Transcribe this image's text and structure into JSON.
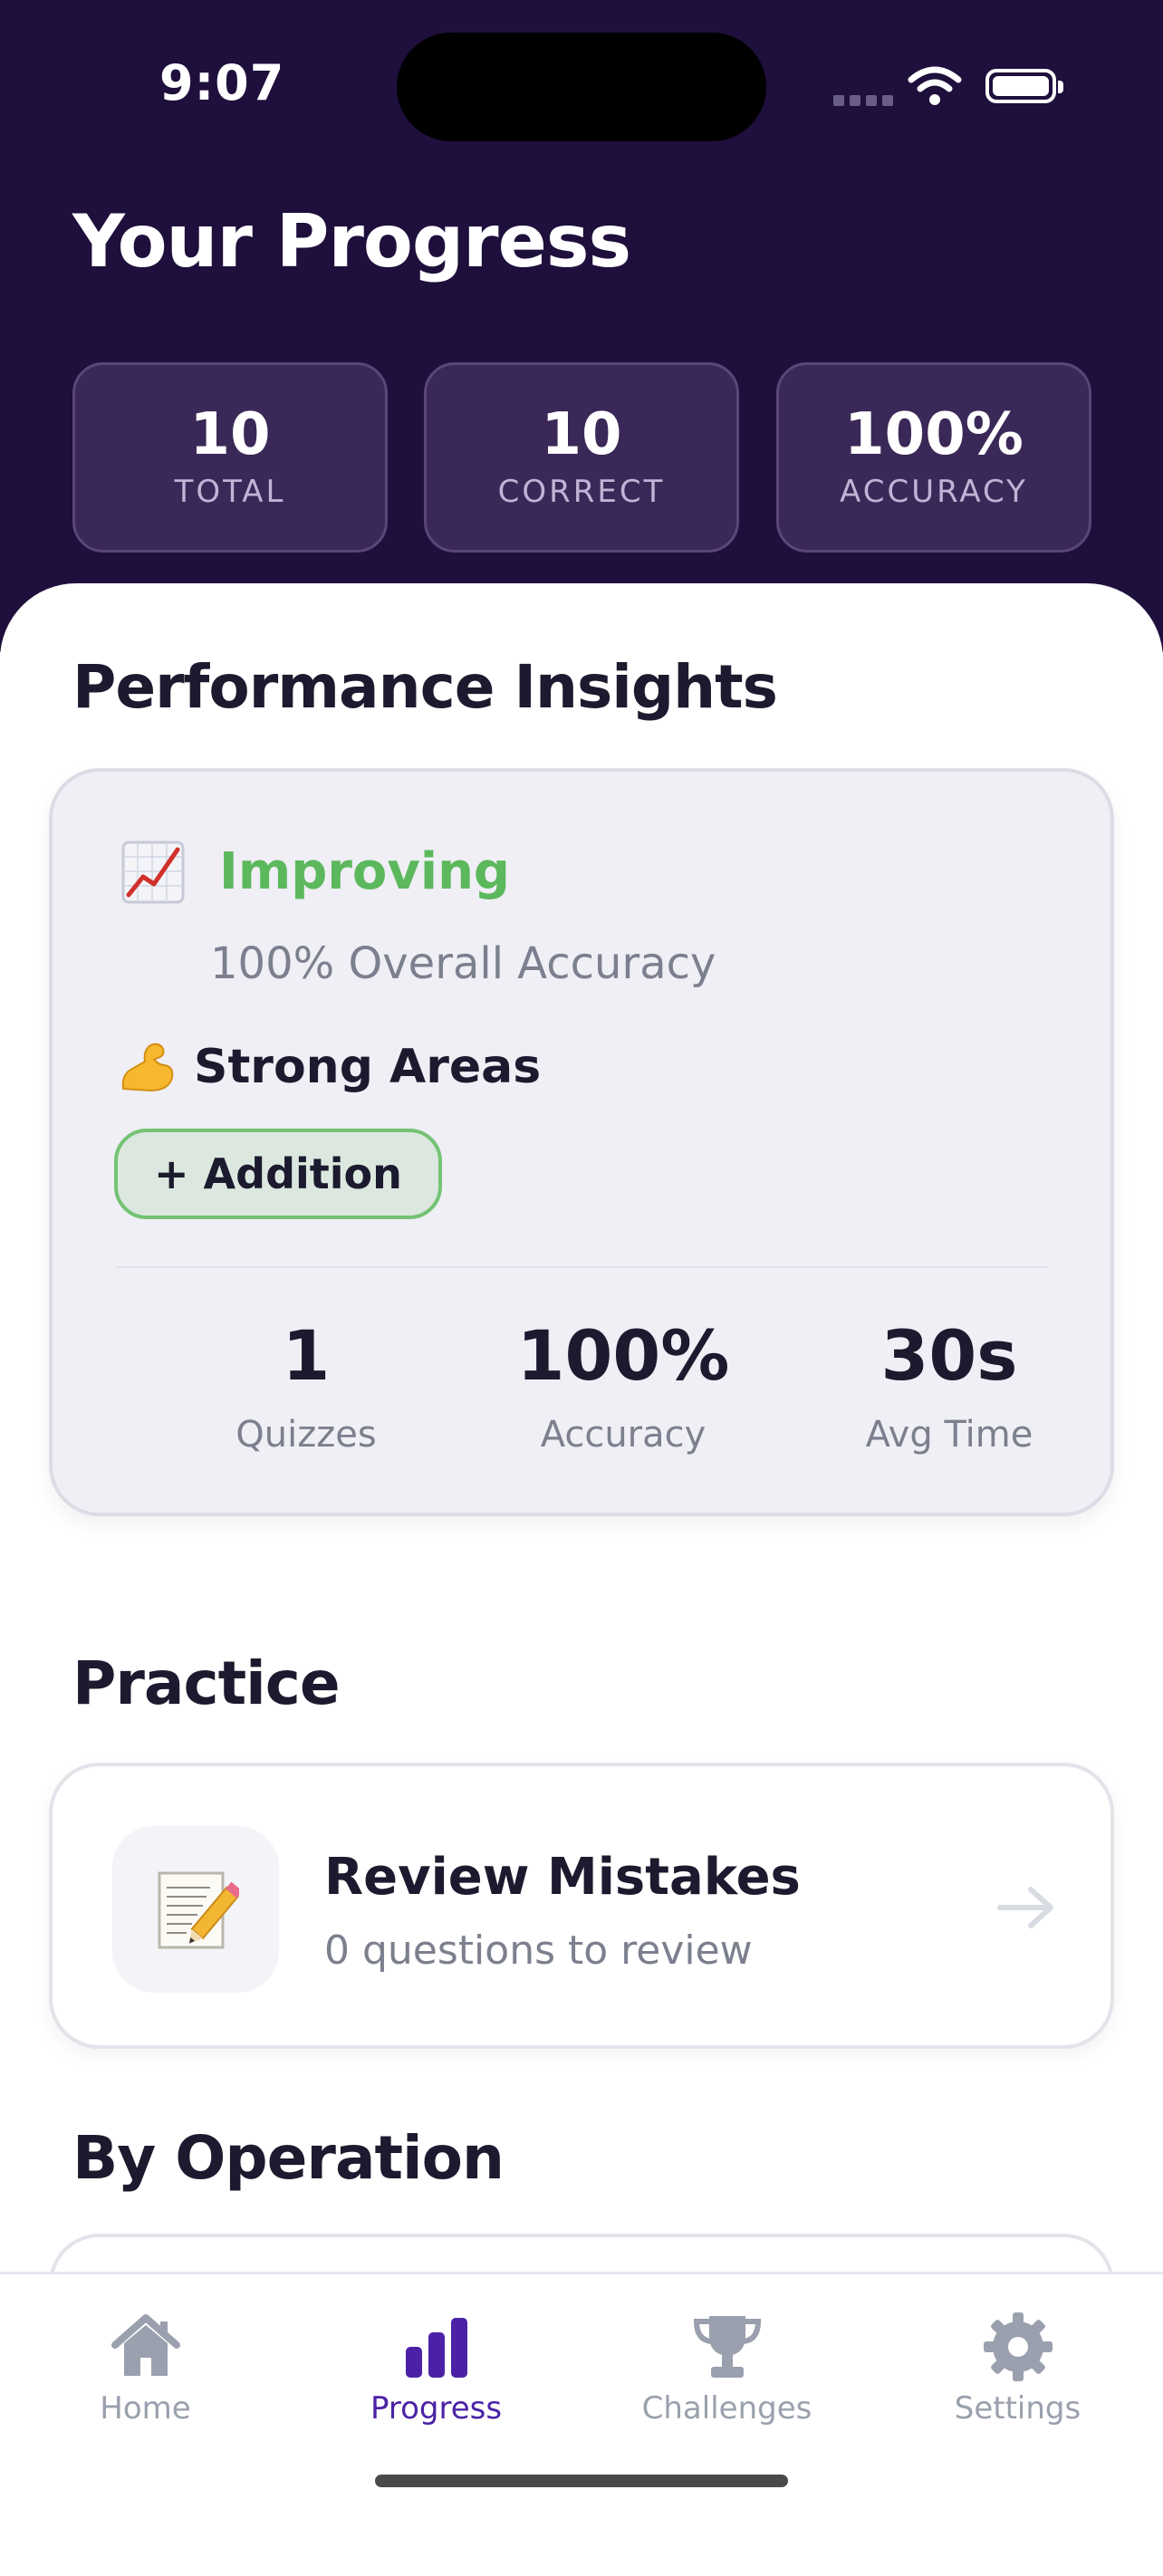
{
  "status_bar": {
    "time": "9:07"
  },
  "header": {
    "title": "Your Progress",
    "stats": [
      {
        "value": "10",
        "label": "TOTAL"
      },
      {
        "value": "10",
        "label": "CORRECT"
      },
      {
        "value": "100%",
        "label": "ACCURACY"
      }
    ]
  },
  "insights": {
    "section_title": "Performance Insights",
    "trend_icon": "chart-increasing-icon",
    "trend_label": "Improving",
    "overall_accuracy": "100% Overall Accuracy",
    "strong_areas_title": "Strong Areas",
    "strong_areas_icon": "flexed-biceps-icon",
    "strong_areas": [
      "+ Addition"
    ],
    "stats": [
      {
        "value": "1",
        "label": "Quizzes"
      },
      {
        "value": "100%",
        "label": "Accuracy"
      },
      {
        "value": "30s",
        "label": "Avg Time"
      }
    ]
  },
  "practice": {
    "section_title": "Practice",
    "review": {
      "icon": "memo-icon",
      "title": "Review Mistakes",
      "subtitle": "0 questions to review"
    }
  },
  "by_operation": {
    "section_title": "By Operation"
  },
  "tab_bar": {
    "tabs": [
      {
        "label": "Home",
        "icon": "home-icon",
        "active": false
      },
      {
        "label": "Progress",
        "icon": "bar-chart-icon",
        "active": true
      },
      {
        "label": "Challenges",
        "icon": "trophy-icon",
        "active": false
      },
      {
        "label": "Settings",
        "icon": "gear-icon",
        "active": false
      }
    ]
  },
  "colors": {
    "header_bg": "#1e0f3c",
    "stat_card_bg": "#3a2858",
    "accent": "#4b22a6",
    "improving_green": "#5cb85c",
    "chip_bg": "#dce8df",
    "chip_border": "#74c374",
    "inactive_tab": "#9aa0ad"
  }
}
